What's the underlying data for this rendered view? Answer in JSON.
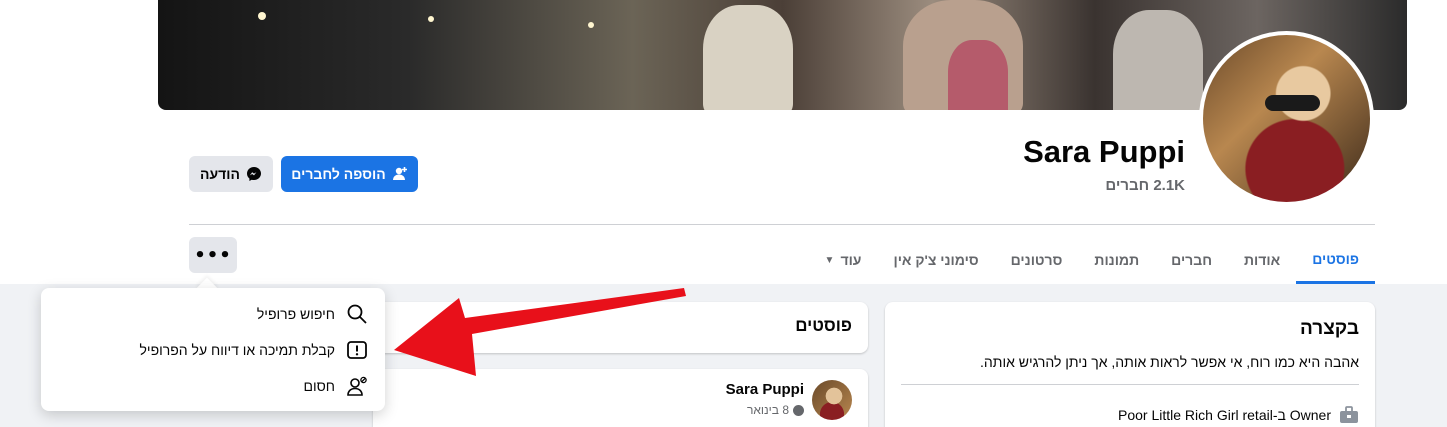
{
  "profile": {
    "name": "Sara Puppi",
    "friends_count": "2.1K",
    "friends_label": "חברים"
  },
  "actions": {
    "add_friend": "הוספה לחברים",
    "message": "הודעה",
    "more": "•••"
  },
  "tabs": [
    {
      "label": "פוסטים",
      "active": true
    },
    {
      "label": "אודות"
    },
    {
      "label": "חברים"
    },
    {
      "label": "תמונות"
    },
    {
      "label": "סרטונים"
    },
    {
      "label": "סימוני צ'ק אין"
    },
    {
      "label": "עוד"
    }
  ],
  "menu": {
    "items": [
      {
        "label": "חיפוש פרופיל",
        "icon": "search-icon"
      },
      {
        "label": "קבלת תמיכה או דיווח על הפרופיל",
        "icon": "report-icon"
      },
      {
        "label": "חסום",
        "icon": "block-user-icon"
      }
    ]
  },
  "intro": {
    "title": "בקצרה",
    "bio": "אהבה היא כמו רוח, אי אפשר לראות אותה, אך ניתן להרגיש אותה.",
    "work": "Poor Little Rich Girl retail-ב Owner"
  },
  "posts": {
    "title": "פוסטים",
    "author": "Sara Puppi",
    "date": "8 בינואר"
  },
  "colors": {
    "accent": "#1b74e4",
    "arrow": "#e8101a"
  }
}
